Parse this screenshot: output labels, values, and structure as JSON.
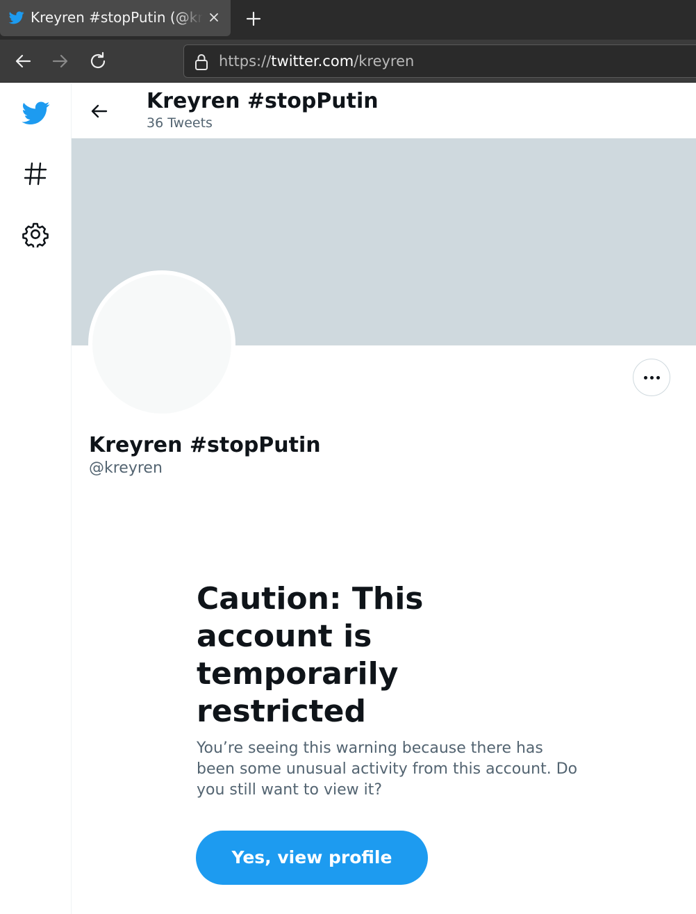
{
  "browser": {
    "tab_title": "Kreyren #stopPutin (@kreyren) / Twitter",
    "url_scheme": "https://",
    "url_host": "twitter.com",
    "url_path": "/kreyren"
  },
  "colors": {
    "brand": "#1d9bf0",
    "banner": "#cfd9de",
    "text_primary": "#0f1419",
    "text_secondary": "#536471"
  },
  "sidebar": {
    "items": [
      {
        "icon": "twitter-logo-icon"
      },
      {
        "icon": "hashtag-icon"
      },
      {
        "icon": "gear-icon"
      }
    ]
  },
  "header": {
    "name": "Kreyren #stopPutin",
    "tweet_count": "36 Tweets"
  },
  "profile": {
    "name": "Kreyren #stopPutin",
    "handle": "@kreyren"
  },
  "caution": {
    "title": "Caution: This account is temporarily restricted",
    "body": "You’re seeing this warning because there has been some unusual activity from this account. Do you still want to view it?",
    "button_label": "Yes, view profile"
  }
}
